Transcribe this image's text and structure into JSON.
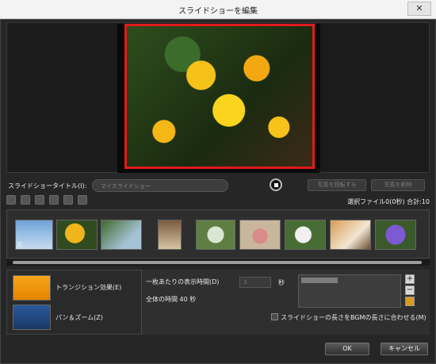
{
  "window": {
    "title": "スライドショーを編集",
    "close_symbol": "✕"
  },
  "slideshow_title": {
    "label": "スライドショータイトル(I):",
    "placeholder": "マイスライドショー"
  },
  "actions": {
    "save": "写真を回転する",
    "save2": "写真を削除"
  },
  "selection_info": "選択ファイル0(0秒) 合計:10",
  "thumb_badge": "万",
  "transition": {
    "label": "トランジション効果(E)"
  },
  "pan_zoom": {
    "label": "パン＆ズーム(Z)"
  },
  "duration": {
    "label": "一枚あたりの表示時間(D)",
    "value": "3",
    "unit": "秒"
  },
  "total": {
    "label": "全体の時間 40 秒"
  },
  "bgm_sync": {
    "label": "スライドショーの長さをBGMの長さに合わせる(M)"
  },
  "buttons": {
    "ok": "OK",
    "cancel": "キャンセル"
  },
  "colors": {
    "accent": "#e21a1a"
  }
}
